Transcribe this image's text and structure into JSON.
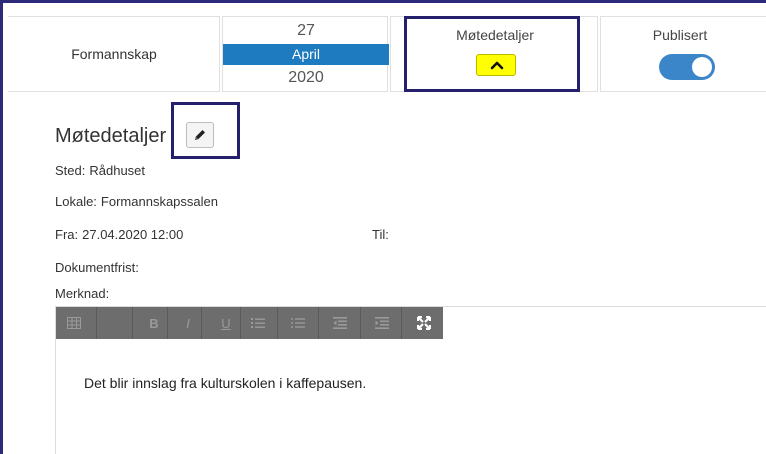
{
  "header": {
    "committee": "Formannskap",
    "date": {
      "day": "27",
      "month": "April",
      "year": "2020"
    },
    "details_toggle": {
      "label": "Møtedetaljer",
      "icon": "chevron-up-icon",
      "state": "expanded"
    },
    "published": {
      "label": "Publisert",
      "on": true
    }
  },
  "details": {
    "title": "Møtedetaljer",
    "edit_icon": "pencil-icon",
    "sted_label": "Sted:",
    "sted_value": "Rådhuset",
    "lokale_label": "Lokale:",
    "lokale_value": "Formannskapssalen",
    "fra_label": "Fra:",
    "fra_value": "27.04.2020 12:00",
    "til_label": "Til:",
    "til_value": "",
    "dokumentfrist_label": "Dokumentfrist:",
    "dokumentfrist_value": "",
    "merknad_label": "Merknad:"
  },
  "editor": {
    "toolbar": [
      {
        "name": "table-icon",
        "glyph": "▦"
      },
      {
        "name": "bold-icon",
        "glyph": "B"
      },
      {
        "name": "italic-icon",
        "glyph": "I"
      },
      {
        "name": "underline-icon",
        "glyph": "U"
      },
      {
        "name": "ordered-list-icon",
        "glyph": "☰"
      },
      {
        "name": "unordered-list-icon",
        "glyph": "☰"
      },
      {
        "name": "outdent-icon",
        "glyph": "☰"
      },
      {
        "name": "indent-icon",
        "glyph": "☰"
      },
      {
        "name": "fullscreen-icon",
        "glyph": "⛶"
      }
    ],
    "content": "Det blir innslag fra kulturskolen i kaffepausen."
  },
  "colors": {
    "accent_blue": "#1f7bc0",
    "toggle_blue": "#3a86c8",
    "highlight_yellow": "#ffff00",
    "annotation_border": "#24206b",
    "toolbar_gray": "#6d6d6d"
  }
}
